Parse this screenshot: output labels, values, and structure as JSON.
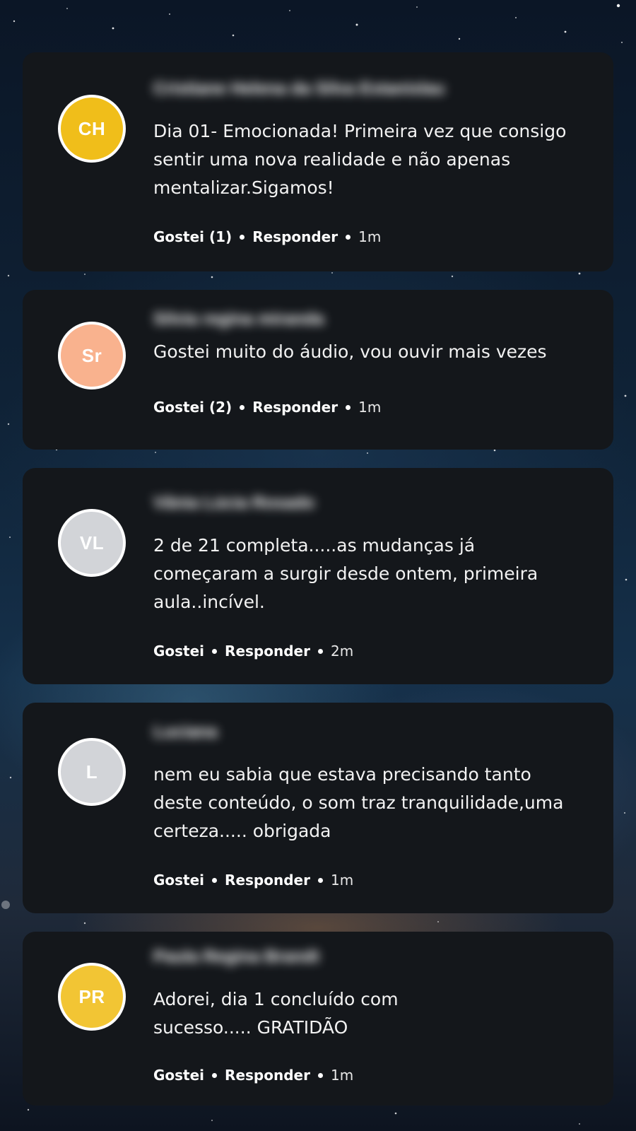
{
  "comments": [
    {
      "initials": "CH",
      "avatar_color": "#F0BE1A",
      "name": "Cristiane Helena da Silva Estanislau",
      "text": "Dia 01- Emocionada! Primeira vez que consigo sentir uma nova realidade e não apenas mentalizar.Sigamos!",
      "like_label": "Gostei (1)",
      "reply_label": "Responder",
      "time": "1m"
    },
    {
      "initials": "Sr",
      "avatar_color": "#F9B28E",
      "name": "Silvia regina miranda",
      "text": "Gostei muito do áudio, vou ouvir mais vezes",
      "like_label": "Gostei (2)",
      "reply_label": "Responder",
      "time": "1m"
    },
    {
      "initials": "VL",
      "avatar_color": "#D2D4D8",
      "name": "Vânia Lúcia Rosado",
      "text": "2 de 21 completa.....as mudanças já começaram a surgir desde ontem, primeira aula..incível.",
      "like_label": "Gostei",
      "reply_label": "Responder",
      "time": "2m"
    },
    {
      "initials": "L",
      "avatar_color": "#D2D4D8",
      "name": "Luciana",
      "text": "nem eu sabia que estava precisando tanto deste conteúdo, o som  traz tranquilidade,uma certeza..... obrigada",
      "like_label": "Gostei",
      "reply_label": "Responder",
      "time": "1m"
    },
    {
      "initials": "PR",
      "avatar_color": "#F2C534",
      "name": "Paula Regina Brandt",
      "text": "Adorei, dia 1 concluído com sucesso..... GRATIDÃO",
      "like_label": "Gostei",
      "reply_label": "Responder",
      "time": "1m"
    }
  ]
}
